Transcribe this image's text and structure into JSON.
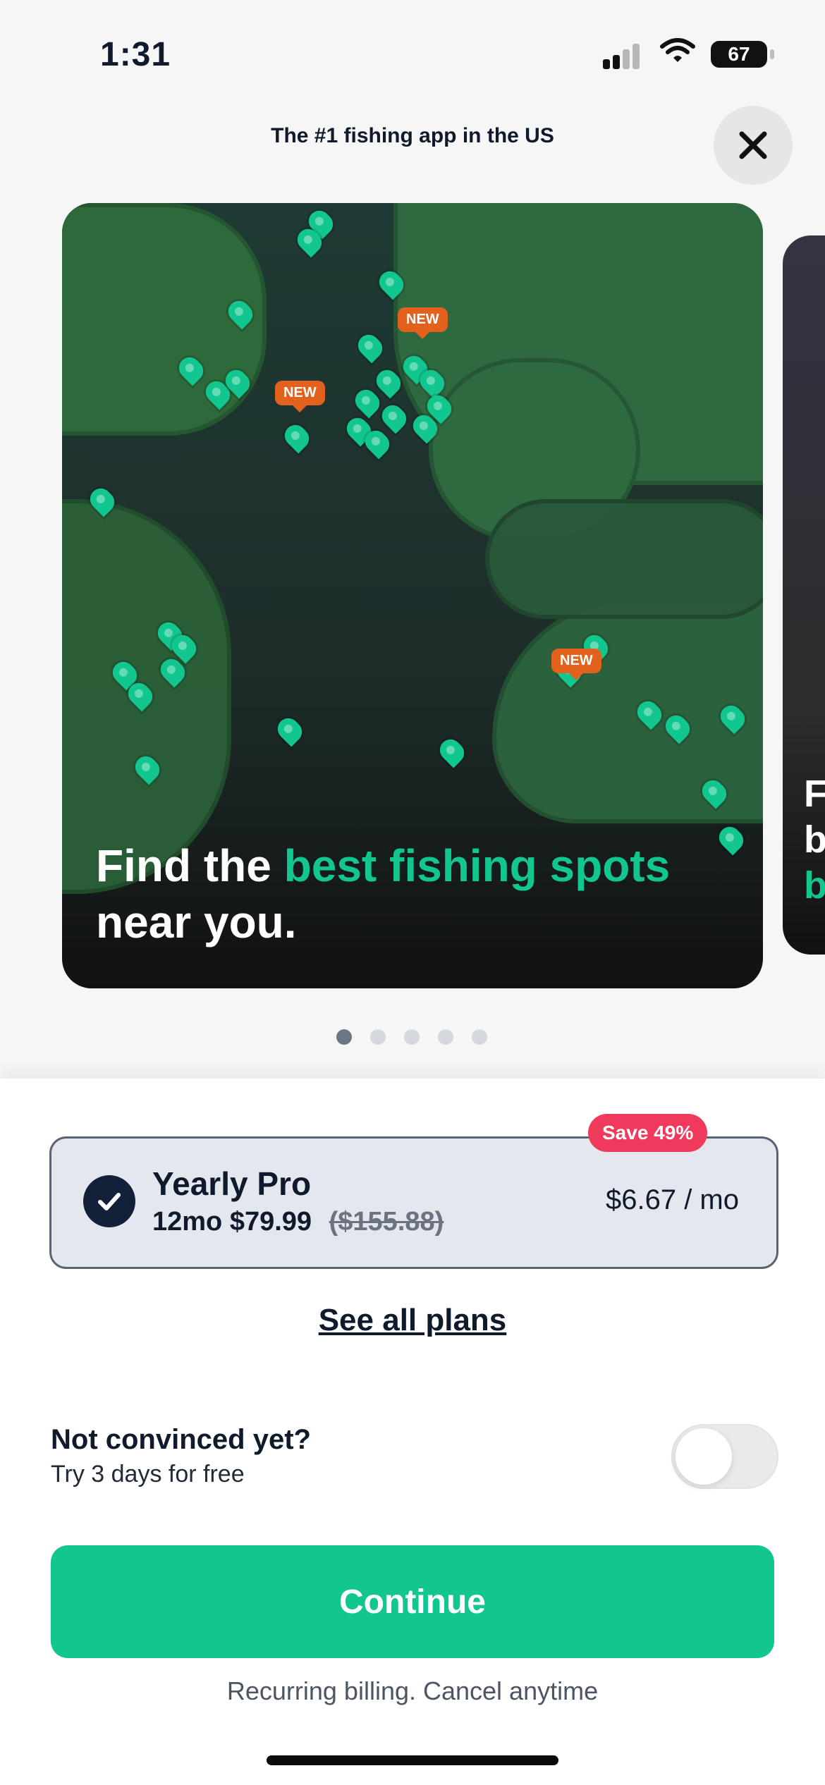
{
  "status_bar": {
    "time": "1:31",
    "battery": "67"
  },
  "header": {
    "title": "The #1 fishing app in the US"
  },
  "carousel": {
    "current_index": 1,
    "total": 5,
    "card": {
      "caption_line1_prefix": "Find the ",
      "caption_line1_highlight": "best fishing spots",
      "caption_line2": "near you.",
      "badges": [
        "NEW",
        "NEW",
        "NEW"
      ]
    },
    "peek_text": {
      "line1": "F",
      "line2": "b",
      "line3": "b"
    }
  },
  "plan": {
    "save_badge": "Save 49%",
    "name": "Yearly Pro",
    "price": "12mo $79.99",
    "old_price": "($155.88)",
    "per_month": "$6.67 / mo"
  },
  "links": {
    "see_all": "See all plans"
  },
  "trial": {
    "title": "Not convinced yet?",
    "subtitle": "Try 3 days for free",
    "enabled": false
  },
  "cta": {
    "continue": "Continue",
    "billing_note": "Recurring billing. Cancel anytime"
  },
  "colors": {
    "accent": "#12C690",
    "save_pill": "#EF3A5B",
    "text": "#0F1B2D"
  }
}
